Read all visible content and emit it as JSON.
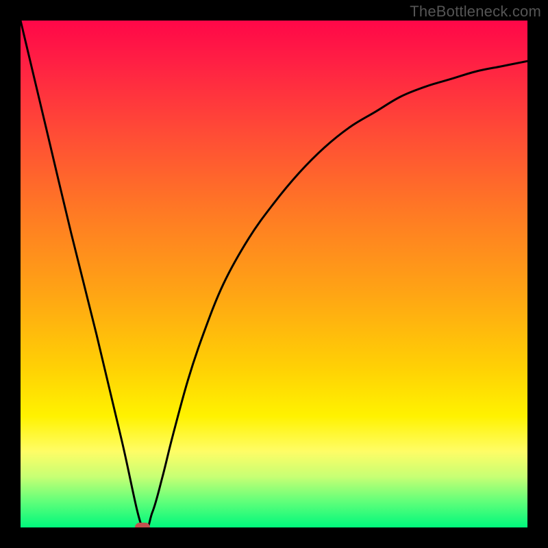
{
  "watermark": "TheBottleneck.com",
  "chart_data": {
    "type": "line",
    "title": "",
    "xlabel": "",
    "ylabel": "",
    "xlim": [
      0,
      100
    ],
    "ylim": [
      0,
      100
    ],
    "grid": false,
    "series": [
      {
        "name": "bottleneck-curve",
        "x": [
          0,
          5,
          10,
          15,
          20,
          24,
          26,
          28,
          30,
          33,
          36,
          40,
          45,
          50,
          55,
          60,
          65,
          70,
          75,
          80,
          85,
          90,
          95,
          100
        ],
        "y": [
          100,
          79,
          58,
          38,
          17,
          0,
          3,
          10,
          18,
          29,
          38,
          48,
          57,
          64,
          70,
          75,
          79,
          82,
          85,
          87,
          88.5,
          90,
          91,
          92
        ]
      }
    ],
    "marker": {
      "x": 24,
      "y": 0
    },
    "background_gradient": {
      "orientation": "vertical",
      "stops": [
        {
          "pos": 0.0,
          "color": "#ff0748"
        },
        {
          "pos": 0.22,
          "color": "#ff4b36"
        },
        {
          "pos": 0.54,
          "color": "#ffa514"
        },
        {
          "pos": 0.78,
          "color": "#fff200"
        },
        {
          "pos": 0.95,
          "color": "#5eff7a"
        },
        {
          "pos": 1.0,
          "color": "#00f77c"
        }
      ]
    }
  }
}
